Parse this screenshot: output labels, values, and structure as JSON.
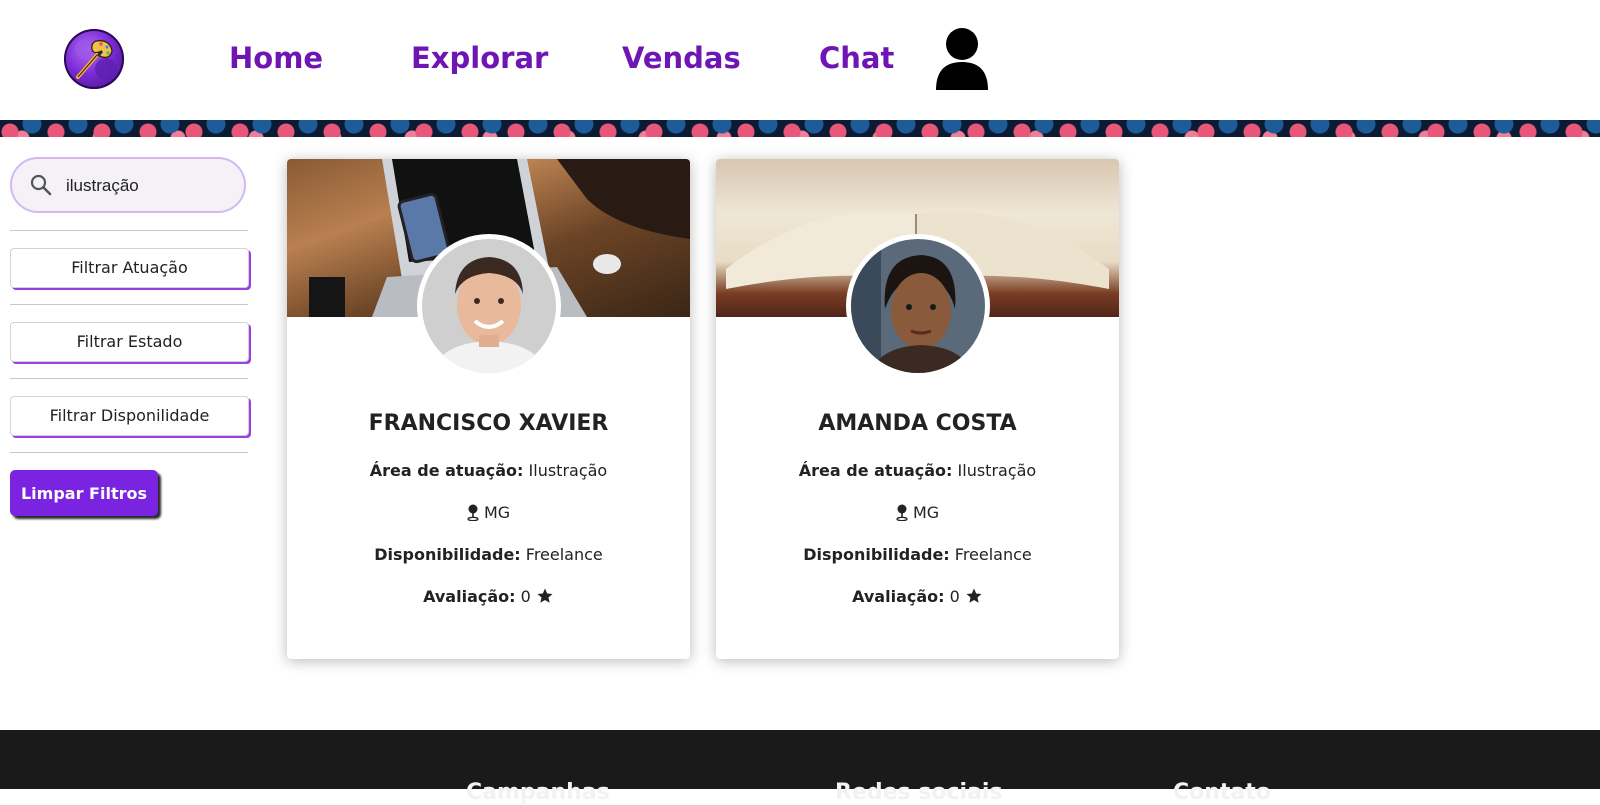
{
  "header": {
    "nav": [
      "Home",
      "Explorar",
      "Vendas",
      "Chat"
    ]
  },
  "sidebar": {
    "search_value": "ilustração",
    "filters": [
      "Filtrar Atuação",
      "Filtrar Estado",
      "Filtrar Disponilidade"
    ],
    "clear_label": "Limpar Filtros"
  },
  "cards": [
    {
      "name": "FRANCISCO XAVIER",
      "area_label": "Área de atuação:",
      "area_value": "Ilustração",
      "state": "MG",
      "availability_label": "Disponibilidade:",
      "availability_value": "Freelance",
      "rating_label": "Avaliação:",
      "rating_value": "0"
    },
    {
      "name": "AMANDA COSTA",
      "area_label": "Área de atuação:",
      "area_value": "Ilustração",
      "state": "MG",
      "availability_label": "Disponibilidade:",
      "availability_value": "Freelance",
      "rating_label": "Avaliação:",
      "rating_value": "0"
    }
  ],
  "footer": {
    "columns": [
      "Campanhas",
      "Redes sociais",
      "Contato"
    ]
  },
  "colors": {
    "accent": "#7a23e0",
    "nav_text": "#6f15b3",
    "footer_bg": "#1a1a1a"
  }
}
